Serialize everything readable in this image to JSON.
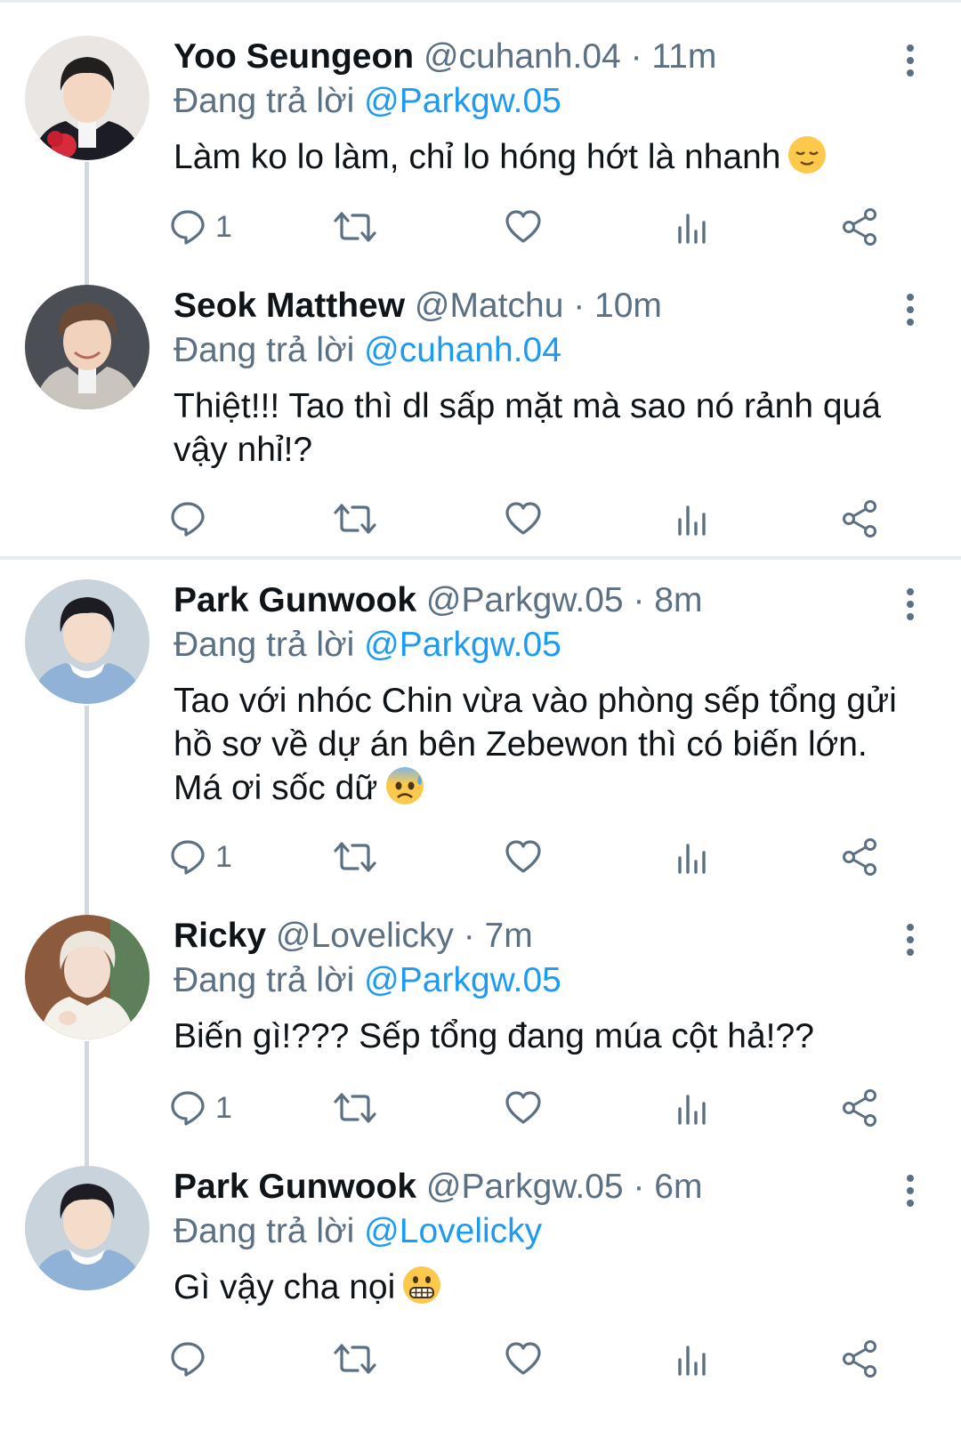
{
  "tweets": [
    {
      "name": "Yoo Seungeon",
      "handle": "@cuhanh.04",
      "time": "· 11m",
      "reply_prefix": "Đang trả lời",
      "reply_to": "@Parkgw.05",
      "text": "Làm ko lo làm, chỉ lo hóng hớt là nhanh",
      "emoji": "relieved-face",
      "reply_count": "1"
    },
    {
      "name": "Seok Matthew",
      "handle": "@Matchu",
      "time": "· 10m",
      "reply_prefix": "Đang trả lời",
      "reply_to": "@cuhanh.04",
      "text": "Thiệt!!! Tao thì dl sấp mặt mà sao nó rảnh quá vậy nhỉ!?",
      "emoji": "",
      "reply_count": ""
    },
    {
      "name": "Park Gunwook",
      "handle": "@Parkgw.05",
      "time": "· 8m",
      "reply_prefix": "Đang trả lời",
      "reply_to": "@Parkgw.05",
      "text": "Tao với nhóc Chin vừa vào phòng sếp tổng gửi hồ sơ về dự án bên Zebewon thì có biến lớn. Má ơi sốc dữ",
      "emoji": "anxious-face-with-sweat",
      "reply_count": "1"
    },
    {
      "name": "Ricky",
      "handle": "@Lovelicky",
      "time": "· 7m",
      "reply_prefix": "Đang trả lời",
      "reply_to": "@Parkgw.05",
      "text": "Biến gì!??? Sếp tổng đang múa cột hả!??",
      "emoji": "",
      "reply_count": "1"
    },
    {
      "name": "Park Gunwook",
      "handle": "@Parkgw.05",
      "time": "· 6m",
      "reply_prefix": "Đang trả lời",
      "reply_to": "@Lovelicky",
      "text": "Gì vậy cha nọi",
      "emoji": "grimacing-face",
      "reply_count": ""
    }
  ],
  "icons": {
    "reply": "reply-bubble-icon",
    "retweet": "retweet-icon",
    "like": "heart-icon",
    "analytics": "analytics-bars-icon",
    "share": "share-icon",
    "more": "more-vertical-icon"
  },
  "colors": {
    "link": "#1d9bf0",
    "secondary_text": "#5b7083",
    "primary_text": "#0f1419",
    "divider": "#e6ecf0"
  }
}
